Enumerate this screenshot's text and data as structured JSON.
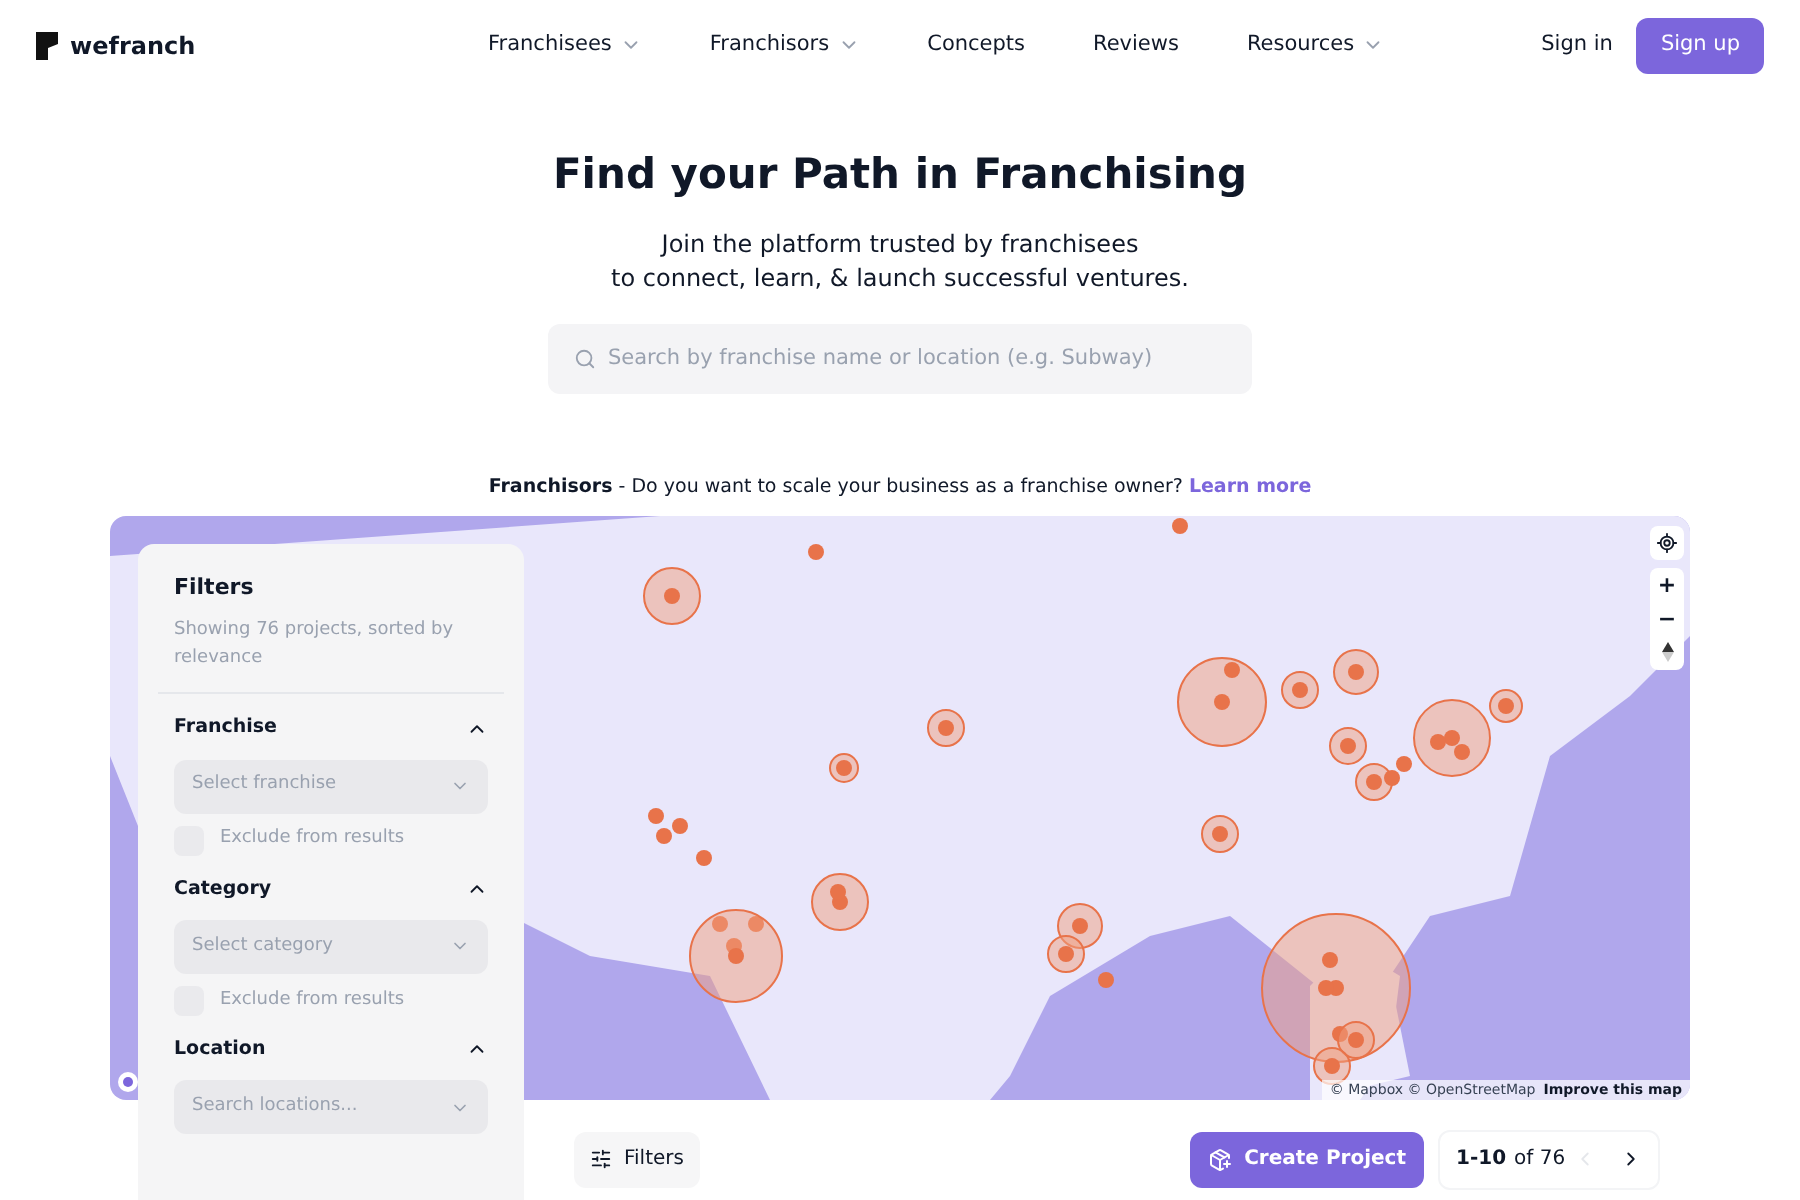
{
  "header": {
    "logo": "wefranch",
    "nav": [
      {
        "label": "Franchisees",
        "dropdown": true
      },
      {
        "label": "Franchisors",
        "dropdown": true
      },
      {
        "label": "Concepts",
        "dropdown": false
      },
      {
        "label": "Reviews",
        "dropdown": false
      },
      {
        "label": "Resources",
        "dropdown": true
      }
    ],
    "sign_in": "Sign in",
    "sign_up": "Sign up"
  },
  "hero": {
    "title": "Find your Path in Franchising",
    "subtitle": [
      "Join the platform trusted by franchisees",
      "to connect, learn, & launch successful ventures."
    ],
    "search": {
      "placeholder": "Search by franchise name or location (e.g. Subway)"
    }
  },
  "banner": {
    "text": "**Franchisors** - Do you want to scale your business as a franchise owner?",
    "link": "Learn more"
  },
  "map": {
    "attribution": "© Mapbox © OpenStreetMap",
    "improve_link": "Improve this map",
    "zoom_in": "+",
    "zoom_out": "−"
  },
  "filters": {
    "title": "Filters",
    "summary": "Showing 76 projects, sorted by relevance",
    "sections": [
      {
        "title": "Franchise",
        "expanded": true,
        "placeholder": "Select franchise",
        "exclude": {
          "label": "Exclude from results",
          "checked": false
        }
      },
      {
        "title": "Category",
        "expanded": true,
        "placeholder": "Select category",
        "exclude": {
          "label": "Exclude from results",
          "checked": false
        }
      },
      {
        "title": "Location",
        "expanded": true,
        "placeholder": "Search locations..."
      }
    ]
  },
  "toolbar": {
    "filters_button": "Filters",
    "create_button": "Create Project",
    "pagination": {
      "range": "1-10",
      "of": "of 76",
      "prev_disabled": true,
      "next_disabled": false
    }
  }
}
